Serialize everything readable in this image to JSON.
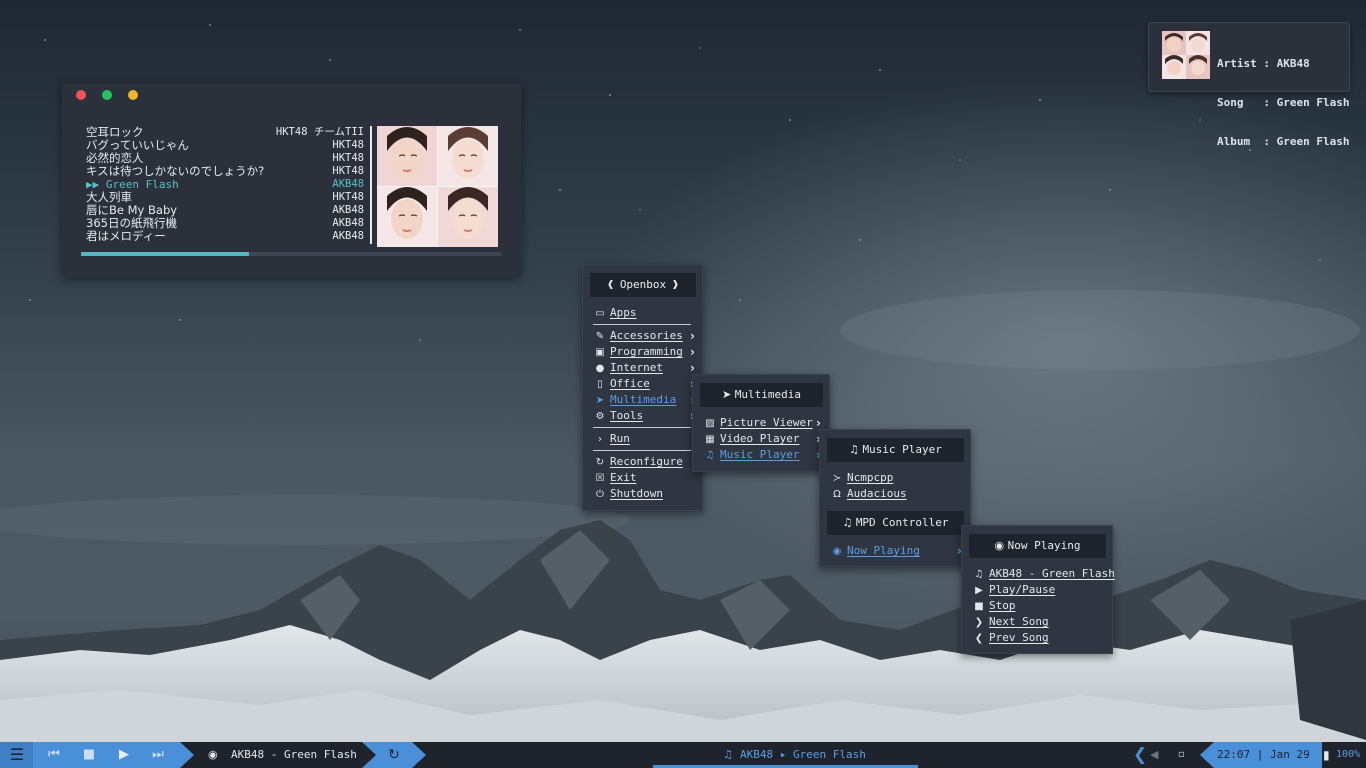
{
  "colors": {
    "accent": "#4a90d9",
    "teal": "#56c2c4",
    "panel": "#2b303b",
    "bar": "#1f232b"
  },
  "notification": {
    "artist_line": "Artist : AKB48",
    "song_line": "Song   : Green Flash",
    "album_line": "Album  : Green Flash"
  },
  "playlist": {
    "rows": [
      {
        "title": "空耳ロック",
        "artist": "HKT48 チームTII"
      },
      {
        "title": "バグっていいじゃん",
        "artist": "HKT48"
      },
      {
        "title": "必然的恋人",
        "artist": "HKT48"
      },
      {
        "title": "キスは待つしかないのでしょうか?",
        "artist": "HKT48"
      },
      {
        "title": "▶▶ Green Flash",
        "artist": "AKB48"
      },
      {
        "title": "大人列車",
        "artist": "HKT48"
      },
      {
        "title": "唇にBe My Baby",
        "artist": "AKB48"
      },
      {
        "title": "365日の紙飛行機",
        "artist": "AKB48"
      },
      {
        "title": "君はメロディー",
        "artist": "AKB48"
      }
    ],
    "current_index": 4,
    "progress_fraction": 0.4
  },
  "openbox_menu": {
    "title": "Openbox",
    "apps": "Apps",
    "items": [
      "Accessories",
      "Programming",
      "Internet",
      "Office",
      "Multimedia",
      "Tools"
    ],
    "run": "Run",
    "reconfigure": "Reconfigure",
    "exit": "Exit",
    "shutdown": "Shutdown"
  },
  "multimedia_menu": {
    "title": "Multimedia",
    "items": [
      "Picture Viewer",
      "Video Player",
      "Music Player"
    ]
  },
  "music_menu": {
    "title": "Music Player",
    "ncmpcpp": "Ncmpcpp",
    "audacious": "Audacious",
    "mpd_title": "MPD Controller",
    "now_playing": "Now Playing"
  },
  "now_playing_menu": {
    "title": "Now Playing",
    "song": "AKB48 - Green Flash",
    "play_pause": "Play/Pause",
    "stop": "Stop",
    "next": "Next Song",
    "prev": "Prev Song"
  },
  "taskbar": {
    "song_left": "AKB48 - Green Flash",
    "song_center": "AKB48 ▸ Green Flash",
    "clock": "22:07 | Jan 29",
    "battery": "100%"
  },
  "icons": [
    "menu-icon",
    "prev-icon",
    "stop-icon",
    "play-icon",
    "next-icon",
    "play-circle-icon",
    "repeat-icon",
    "music-note-icon",
    "chevron-left-icon",
    "volume-icon",
    "battery-icon"
  ]
}
